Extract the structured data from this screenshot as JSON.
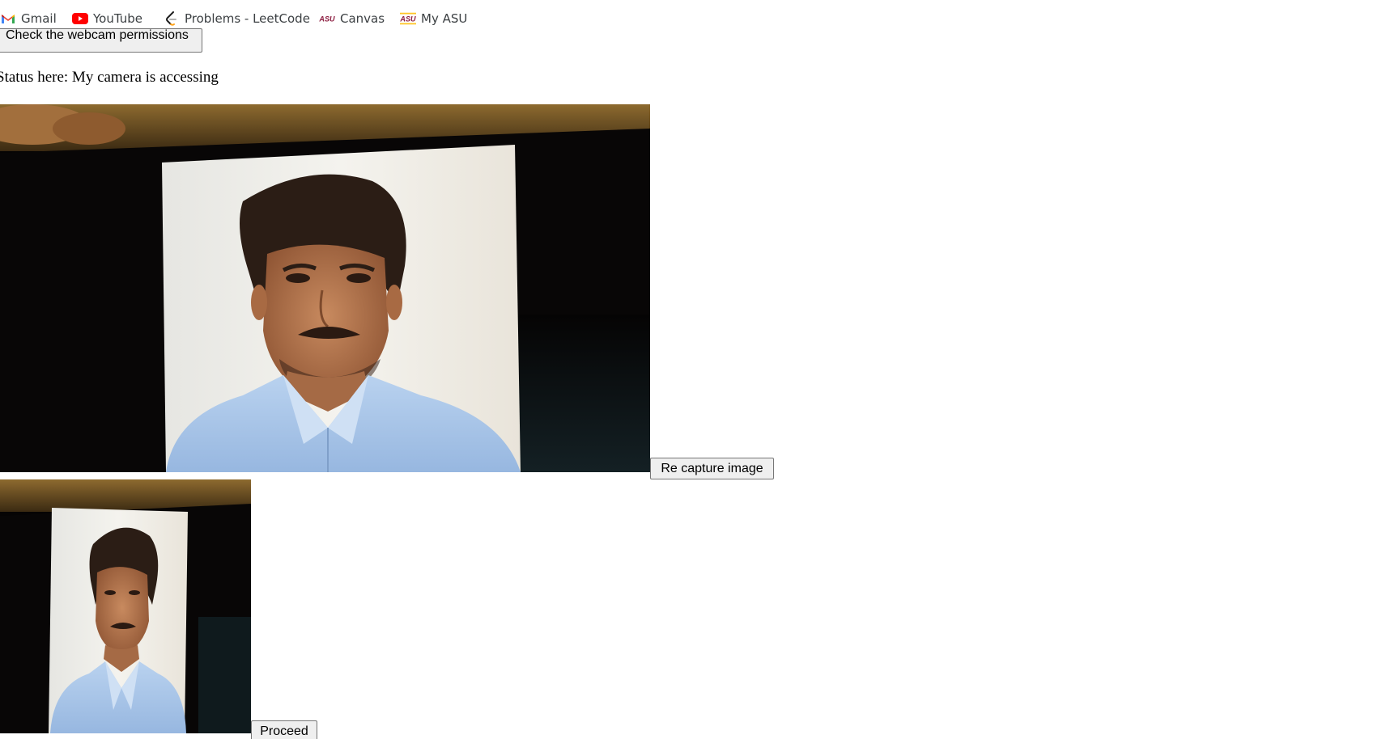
{
  "bookmarks": [
    {
      "label": "Gmail",
      "icon": "gmail-icon"
    },
    {
      "label": "YouTube",
      "icon": "youtube-icon"
    },
    {
      "label": "Problems - LeetCode",
      "icon": "leetcode-icon"
    },
    {
      "label": "Canvas",
      "icon": "asu-icon"
    },
    {
      "label": "My ASU",
      "icon": "asu-icon"
    }
  ],
  "buttons": {
    "check_permissions": "Check the webcam permissions",
    "recapture": "Re capture image",
    "proceed": "Proceed"
  },
  "status": {
    "text": "Status here: My camera is accessing"
  },
  "colors": {
    "youtube_red": "#ff0000",
    "asu_maroon": "#8c1d40",
    "asu_gold": "#ffc627",
    "shirt_blue": "#a9c7ea"
  }
}
